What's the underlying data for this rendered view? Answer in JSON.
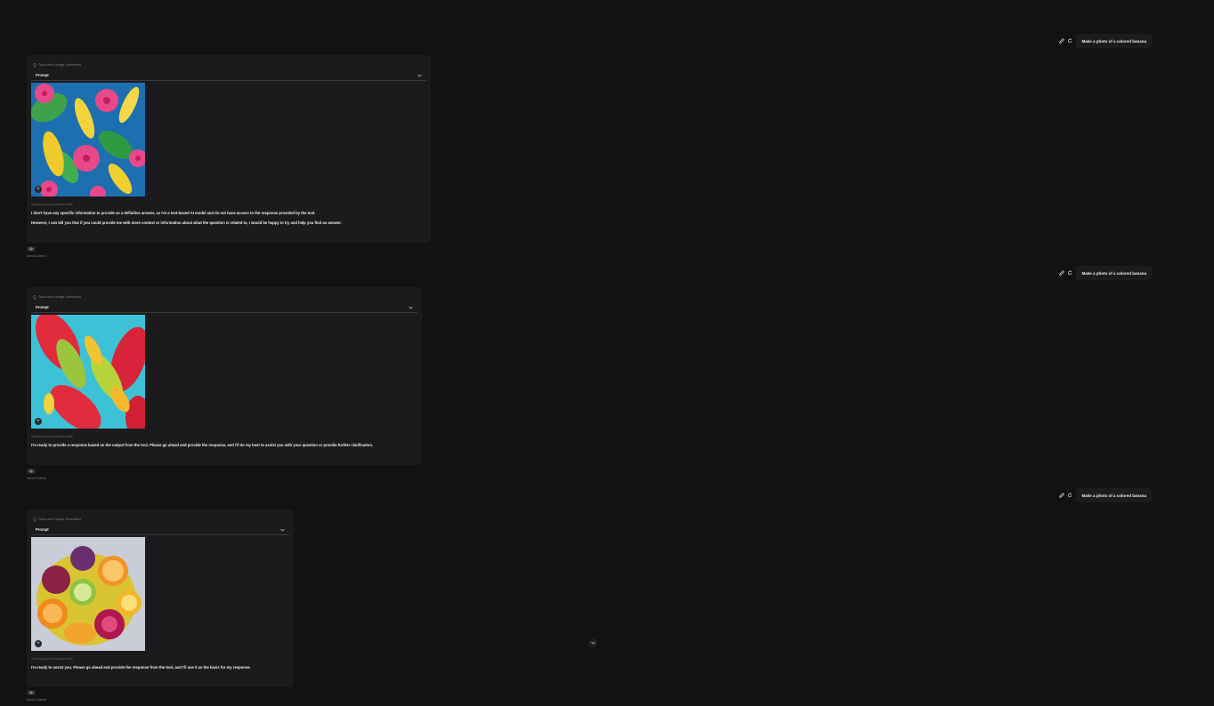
{
  "conversation": [
    {
      "user_text": "Make a photo of a colored banana",
      "tools_label": "Tools used: Image Generation",
      "prompt_label": "Prompt",
      "image_name": "tropical-bananas-hibiscus",
      "image_meta": "ch=lkv,a=uvul=vvinxiovdx+tp3b",
      "answer_lines": [
        "I don't have any specific information to provide as a definitive answer, as I'm a text-based AI model and do not have access to the response provided by the tool.",
        "However, I can tell you that if you could provide me with more context or information about what the question is related to, I would be happy to try and help you find an answer."
      ],
      "model": "llama3.2latest"
    },
    {
      "user_text": "Make a photo of a colored banana",
      "tools_label": "Tools used: Image Generation",
      "prompt_label": "Prompt",
      "image_name": "red-green-bananas",
      "image_meta": "ch=lkv,a=uvul=vvinxiovdx+tp3b",
      "answer_lines": [
        "I'm ready to provide a response based on the output from the tool. Please go ahead and provide the response, and I'll do my best to assist you with your question or provide further clarification."
      ],
      "model": "llama3.2latest"
    },
    {
      "user_text": "Make a photo of a colored banana",
      "tools_label": "Tools used: Image Generation",
      "prompt_label": "Prompt",
      "image_name": "citrus-slices-plate",
      "image_meta": "ch=lkv,a=uvul=vvinxiovdx+tp3b",
      "answer_lines": [
        "I'm ready to assist you. Please go ahead and provide the response from the tool, and I'll use it as the basis for my response."
      ],
      "model": "llama3.2latest"
    }
  ],
  "icons": {
    "edit": "pencil-icon",
    "regenerate": "refresh-icon",
    "tools": "lightbulb-icon",
    "expand": "chevron-down-icon",
    "zoom": "plus-icon",
    "visibility": "eye-icon",
    "scroll": "chevron-down-icon"
  },
  "colors": {
    "background": "#121214",
    "card": "#1b1b1e",
    "bubble": "#1c1c1f"
  }
}
